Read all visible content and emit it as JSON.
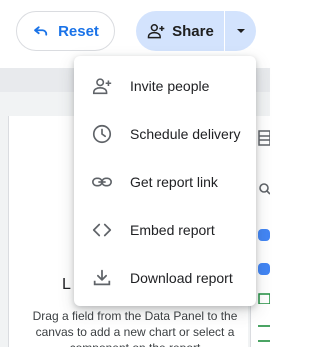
{
  "toolbar": {
    "reset_label": "Reset",
    "share_label": "Share"
  },
  "share_menu": {
    "items": [
      {
        "label": "Invite people",
        "icon": "person-add-icon"
      },
      {
        "label": "Schedule delivery",
        "icon": "schedule-icon"
      },
      {
        "label": "Get report link",
        "icon": "link-icon"
      },
      {
        "label": "Embed report",
        "icon": "code-icon"
      },
      {
        "label": "Download report",
        "icon": "download-icon"
      }
    ]
  },
  "canvas": {
    "big_letter": "L",
    "hint": "Drag a field from the Data Panel to the canvas to add a new chart or select a component on the report"
  },
  "colors": {
    "accent": "#1a73e8",
    "share_bg": "#d3e3fd",
    "icon_gray": "#5f6368"
  }
}
